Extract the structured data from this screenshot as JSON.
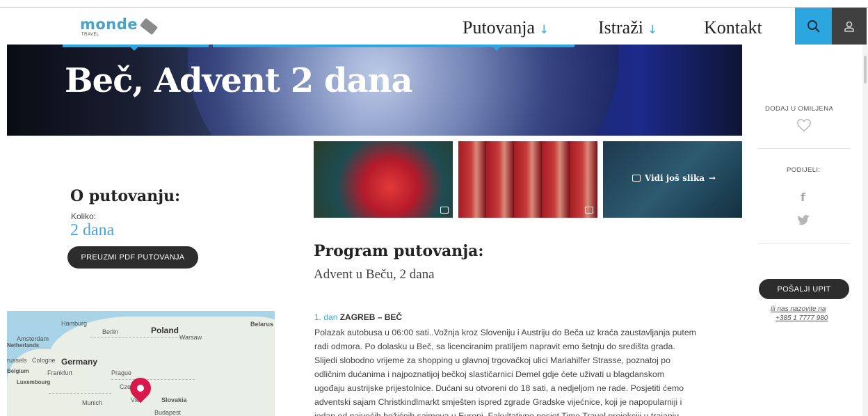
{
  "header": {
    "logo_text": "monde",
    "logo_sub": "TRAVEL",
    "nav": [
      {
        "label": "Putovanja",
        "arrow": "↓"
      },
      {
        "label": "Istraži",
        "arrow": "↓"
      },
      {
        "label": "Kontakt"
      }
    ],
    "accent_color": "#2ba6df"
  },
  "hero": {
    "title": "Beč, Advent 2 dana"
  },
  "gallery": {
    "more_label": "Vidi još slika",
    "more_arrow": "→"
  },
  "about": {
    "title": "O putovanju:",
    "duration_label": "Koliko:",
    "duration_value": "2 dana",
    "pdf_button": "PREUZMI PDF PUTOVANJA"
  },
  "map": {
    "labels": {
      "hamburg": "Hamburg",
      "berlin": "Berlin",
      "poland": "Poland",
      "warsaw": "Warsaw",
      "belarus": "Belarus",
      "amsterdam": "Amsterdam",
      "netherlands": "Netherlands",
      "brussels": "russels",
      "cologne": "Cologne",
      "germany": "Germany",
      "belgium": "Belgium",
      "frankfurt": "Frankfurt",
      "prague": "Prague",
      "luxembourg": "Luxembourg",
      "czech": "Czec",
      "munich": "Munich",
      "vienna": "Vie",
      "slovakia": "Slovakia",
      "budapest": "Budapest"
    }
  },
  "program": {
    "title": "Program putovanja:",
    "subtitle": "Advent u Beču, 2 dana",
    "days": [
      {
        "number": "1. dan",
        "title": "ZAGREB – BEČ",
        "lines": [
          "Polazak autobusa u 06:00 sati..Vožnja kroz Sloveniju i Austriju do Beča uz kraća zaustavljanja putem",
          "radi odmora. Po dolasku u Beč, sa licenciranim pratiljem napravit emo šetnju do središta grada.",
          "Slijedi slobodno vrijeme za shopping u glavnoj trgovačkoj ulici Mariahilfer Strasse, poznatoj po",
          "odličnim dućanima i najpoznatijoj bečkoj slastičarnici Demel gdje ćete uživati  u blagdanskom",
          "ugođaju austrijske prijestolnice. Dućani su otvoreni do 18 sati, a nedjeljom ne rade. Posjetiti ćemo",
          "adventski sajam Christkindlmarkt  smješten ispred zgrade Gradske vijećnice, koji je napopularniji i",
          "jedan od najvećih božićnih sajmova u Europi.  Fakultativno posjet Time Travel projekciji u trajanju"
        ]
      }
    ]
  },
  "sidebar": {
    "favorites_label": "DODAJ U OMILJENA",
    "share_label": "PODIJELI:",
    "inquiry_button": "POŠALJI UPIT",
    "call_line1": "ili nas nazovite na",
    "call_line2": "+385 1 7777 980"
  }
}
